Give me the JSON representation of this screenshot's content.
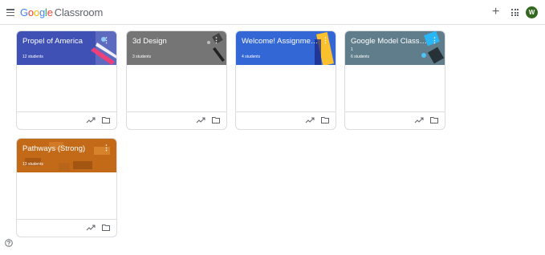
{
  "app": {
    "logo_google_letters": [
      "G",
      "o",
      "o",
      "g",
      "l",
      "e"
    ],
    "logo_product": "Classroom",
    "avatar_letter": "W"
  },
  "colors": {
    "card_header_1": "#3f51b5",
    "card_header_2": "#757575",
    "card_header_3": "#3367d6",
    "card_header_4": "#607d8b",
    "card_header_5": "#c26a18",
    "avatar": "#33691e"
  },
  "icons": [
    "menu-icon",
    "plus-icon",
    "apps-icon",
    "trend-icon",
    "folder-icon",
    "more-vert-icon",
    "help-icon"
  ],
  "cards": [
    {
      "title": "Propel of America",
      "section": "",
      "students": "12 students"
    },
    {
      "title": "3d Design",
      "section": "",
      "students": "3 students"
    },
    {
      "title": "Welcome! Assignmen...",
      "section": "",
      "students": "4 students"
    },
    {
      "title": "Google Model Classr...",
      "section": "1",
      "students": "6 students"
    },
    {
      "title": "Pathways (Strong)",
      "section": "",
      "students": "13 students"
    }
  ]
}
